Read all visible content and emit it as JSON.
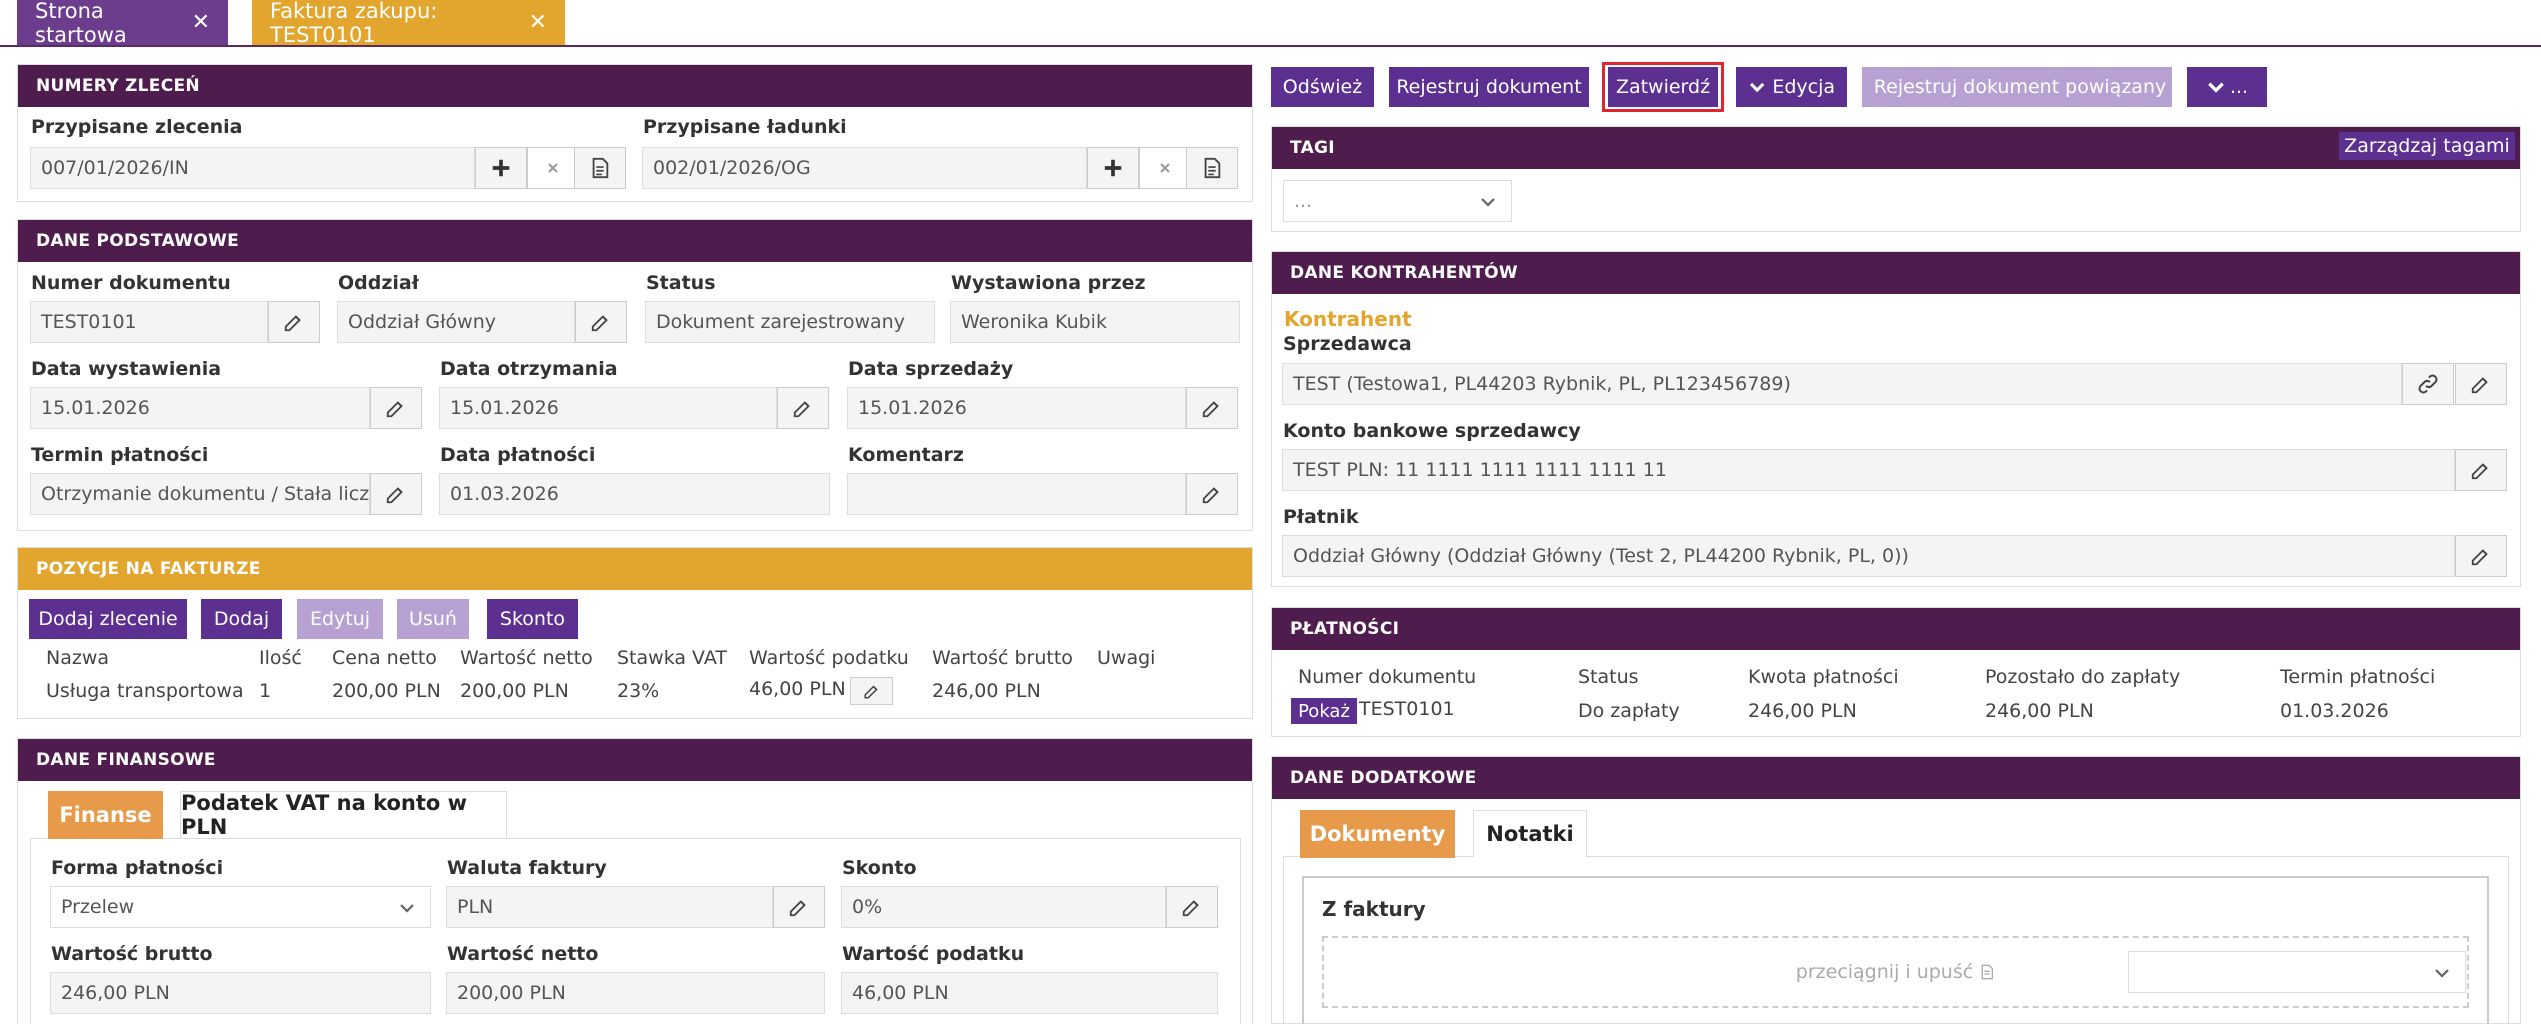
{
  "tabs": [
    {
      "label": "Strona startowa"
    },
    {
      "label": "Faktura zakupu: TEST0101"
    }
  ],
  "numery_zlecen": {
    "title": "NUMERY ZLECEŃ",
    "orders_label": "Przypisane zlecenia",
    "orders_value": "007/01/2026/IN",
    "loads_label": "Przypisane ładunki",
    "loads_value": "002/01/2026/OG"
  },
  "dane_podstawowe": {
    "title": "DANE PODSTAWOWE",
    "numer_label": "Numer dokumentu",
    "numer_value": "TEST0101",
    "oddzial_label": "Oddział",
    "oddzial_value": "Oddział Główny",
    "status_label": "Status",
    "status_value": "Dokument zarejestrowany",
    "wystawiona_label": "Wystawiona przez",
    "wystawiona_value": "Weronika Kubik",
    "data_wyst_label": "Data wystawienia",
    "data_wyst_value": "15.01.2026",
    "data_otrz_label": "Data otrzymania",
    "data_otrz_value": "15.01.2026",
    "data_sprz_label": "Data sprzedaży",
    "data_sprz_value": "15.01.2026",
    "termin_label": "Termin płatności",
    "termin_value": "Otrzymanie dokumentu / Stała liczba",
    "data_platn_label": "Data płatności",
    "data_platn_value": "01.03.2026",
    "komentarz_label": "Komentarz",
    "komentarz_value": ""
  },
  "pozycje": {
    "title": "POZYCJE NA FAKTURZE",
    "buttons": {
      "dodaj_zlecenie": "Dodaj zlecenie",
      "dodaj": "Dodaj",
      "edytuj": "Edytuj",
      "usun": "Usuń",
      "skonto": "Skonto"
    },
    "columns": [
      "Nazwa",
      "Ilość",
      "Cena netto",
      "Wartość netto",
      "Stawka VAT",
      "Wartość podatku",
      "Wartość brutto",
      "Uwagi"
    ],
    "row": [
      "Usługa transportowa",
      "1",
      "200,00 PLN",
      "200,00 PLN",
      "23%",
      "46,00 PLN",
      "246,00 PLN",
      ""
    ]
  },
  "dane_finansowe": {
    "title": "DANE FINANSOWE",
    "tab_finanse": "Finanse",
    "tab_vat": "Podatek VAT na konto w PLN",
    "forma_label": "Forma płatności",
    "forma_value": "Przelew",
    "waluta_label": "Waluta faktury",
    "waluta_value": "PLN",
    "skonto_label": "Skonto",
    "skonto_value": "0%",
    "brutto_label": "Wartość brutto",
    "brutto_value": "246,00 PLN",
    "netto_label": "Wartość netto",
    "netto_value": "200,00 PLN",
    "podatek_label": "Wartość podatku",
    "podatek_value": "46,00 PLN"
  },
  "toolbar": {
    "odswiez": "Odśwież",
    "rejestruj": "Rejestruj dokument",
    "zatwierdz": "Zatwierdź",
    "edycja": "Edycja",
    "rejestruj_powiazany": "Rejestruj dokument powiązany",
    "more": "..."
  },
  "tagi": {
    "title": "TAGI",
    "manage": "Zarządzaj tagami",
    "select_value": "..."
  },
  "kontrahenci": {
    "title": "DANE KONTRAHENTÓW",
    "section": "Kontrahent",
    "sprzedawca_label": "Sprzedawca",
    "sprzedawca_value": "TEST (Testowa1, PL44203 Rybnik, PL, PL123456789)",
    "konto_label": "Konto bankowe sprzedawcy",
    "konto_value": "TEST PLN: 11 1111 1111 1111 1111 11",
    "platnik_label": "Płatnik",
    "platnik_value": "Oddział Główny  (Oddział Główny  (Test 2, PL44200 Rybnik, PL, 0))"
  },
  "platnosci": {
    "title": "PŁATNOŚCI",
    "columns": [
      "Numer dokumentu",
      "Status",
      "Kwota płatności",
      "Pozostało do zapłaty",
      "Termin płatności"
    ],
    "show_btn": "Pokaż",
    "row": [
      "TEST0101",
      "Do zapłaty",
      "246,00 PLN",
      "246,00 PLN",
      "01.03.2026"
    ]
  },
  "dane_dodatkowe": {
    "title": "DANE DODATKOWE",
    "tab_dokumenty": "Dokumenty",
    "tab_notatki": "Notatki",
    "z_faktury": "Z faktury",
    "dropzone": "przeciągnij i upuść"
  },
  "colors": {
    "header_purple": "#4e1d4d",
    "button_purple": "#5c3090",
    "gold": "#e2a52e",
    "highlight_red": "#e0262f"
  }
}
